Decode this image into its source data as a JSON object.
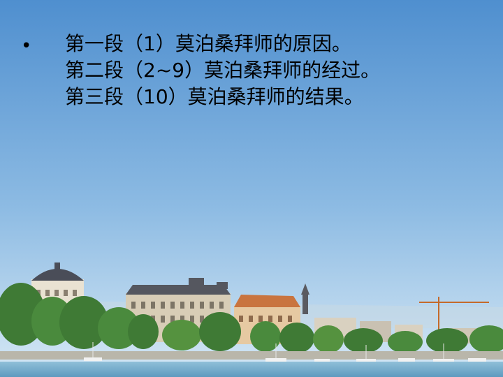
{
  "slide": {
    "bullet": "•",
    "lines": [
      "第一段（1）莫泊桑拜师的原因。",
      "第二段（2~9）莫泊桑拜师的经过。",
      "第三段（10）莫泊桑拜师的结果。"
    ]
  },
  "colors": {
    "sky_top": "#4f8fcf",
    "sky_bottom": "#cfe4f4",
    "trees": "#3f7a35",
    "water": "#6fa9c9"
  }
}
